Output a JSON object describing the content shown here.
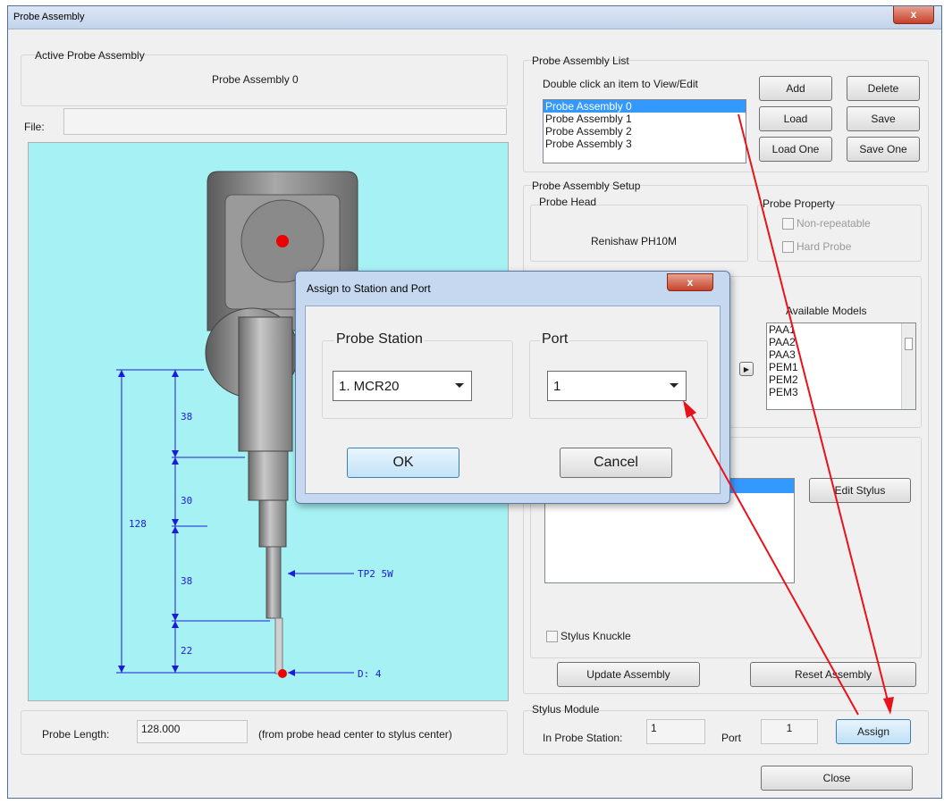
{
  "window": {
    "title": "Probe Assembly",
    "close_glyph": "x"
  },
  "active": {
    "group_title": "Active Probe Assembly",
    "name": "Probe Assembly 0"
  },
  "file": {
    "label": "File:",
    "value": ""
  },
  "drawing": {
    "dims": [
      "38",
      "30",
      "128",
      "38",
      "22"
    ],
    "tip_label": "TP2 5W",
    "diameter_label": "D: 4",
    "bg_color": "#a6f1f4",
    "dim_color": "#1b1bd9",
    "marker_color": "#ee0000"
  },
  "probe_length": {
    "label": "Probe Length:",
    "value": "128.000",
    "note": "(from probe head center to stylus center)"
  },
  "assembly_list": {
    "group_title": "Probe Assembly List",
    "hint": "Double click an item to View/Edit",
    "items": [
      "Probe Assembly 0",
      "Probe Assembly 1",
      "Probe Assembly 2",
      "Probe Assembly 3"
    ],
    "selected_index": 0
  },
  "buttons": {
    "add": "Add",
    "delete": "Delete",
    "load": "Load",
    "save": "Save",
    "load_one": "Load One",
    "save_one": "Save One",
    "edit_stylus": "Edit Stylus",
    "update_assembly": "Update Assembly",
    "reset_assembly": "Reset Assembly",
    "assign": "Assign",
    "close": "Close"
  },
  "setup": {
    "group_title": "Probe Assembly Setup",
    "head_title": "Probe Head",
    "head_value": "Renishaw PH10M",
    "property_title": "Probe Property",
    "non_repeatable": "Non-repeatable",
    "hard_probe": "Hard Probe"
  },
  "models": {
    "title": "Available Models",
    "items": [
      "PAA1",
      "PAA2",
      "PAA3",
      "PEM1",
      "PEM2",
      "PEM3"
    ]
  },
  "stylus_knuckle": "Stylus Knuckle",
  "stylus_module": {
    "group_title": "Stylus Module",
    "station_label": "In Probe Station:",
    "station_value": "1",
    "port_label": "Port",
    "port_value": "1"
  },
  "modal": {
    "title": "Assign to Station and Port",
    "close_glyph": "x",
    "station_title": "Probe Station",
    "station_value": "1. MCR20",
    "port_title": "Port",
    "port_value": "1",
    "ok": "OK",
    "cancel": "Cancel"
  },
  "annotation_color": "#e8121b"
}
